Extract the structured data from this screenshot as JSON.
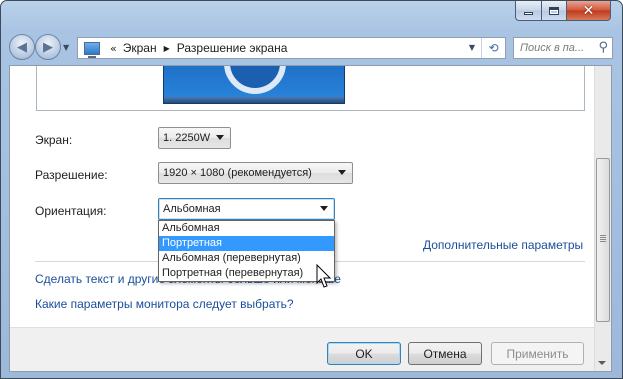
{
  "window": {
    "minimize_icon": "minimize-icon",
    "maximize_icon": "maximize-icon",
    "close_glyph": "✕"
  },
  "nav": {
    "back_icon": "back-arrow-icon",
    "forward_icon": "forward-arrow-icon",
    "back_glyph": "◀",
    "forward_glyph": "▶",
    "history_glyph": "▼"
  },
  "address": {
    "icon": "control-panel-icon",
    "prefix": "«",
    "crumbs": [
      "Экран",
      "Разрешение экрана"
    ],
    "separator": "▶",
    "dropdown_glyph": "▼",
    "refresh_glyph": "⟲"
  },
  "search": {
    "placeholder": "Поиск в па...",
    "icon": "search-icon",
    "glyph": "⚲"
  },
  "settings": {
    "display_label": "Экран:",
    "display_value": "1. 2250W",
    "resolution_label": "Разрешение:",
    "resolution_value": "1920 × 1080 (рекомендуется)",
    "orientation_label": "Ориентация:",
    "orientation_value": "Альбомная",
    "orientation_options": [
      "Альбомная",
      "Портретная",
      "Альбомная (перевернутая)",
      "Портретная (перевернутая)"
    ],
    "orientation_highlighted_index": 1
  },
  "links": {
    "advanced": "Дополнительные параметры",
    "text_size": "Сделать текст и другие элементы больше или меньше",
    "which_settings": "Какие параметры монитора следует выбрать?"
  },
  "buttons": {
    "ok": "OK",
    "cancel": "Отмена",
    "apply": "Применить"
  },
  "colors": {
    "link": "#1a4e9a",
    "highlight": "#3399ff",
    "titlebar": "#a9c4e3"
  }
}
